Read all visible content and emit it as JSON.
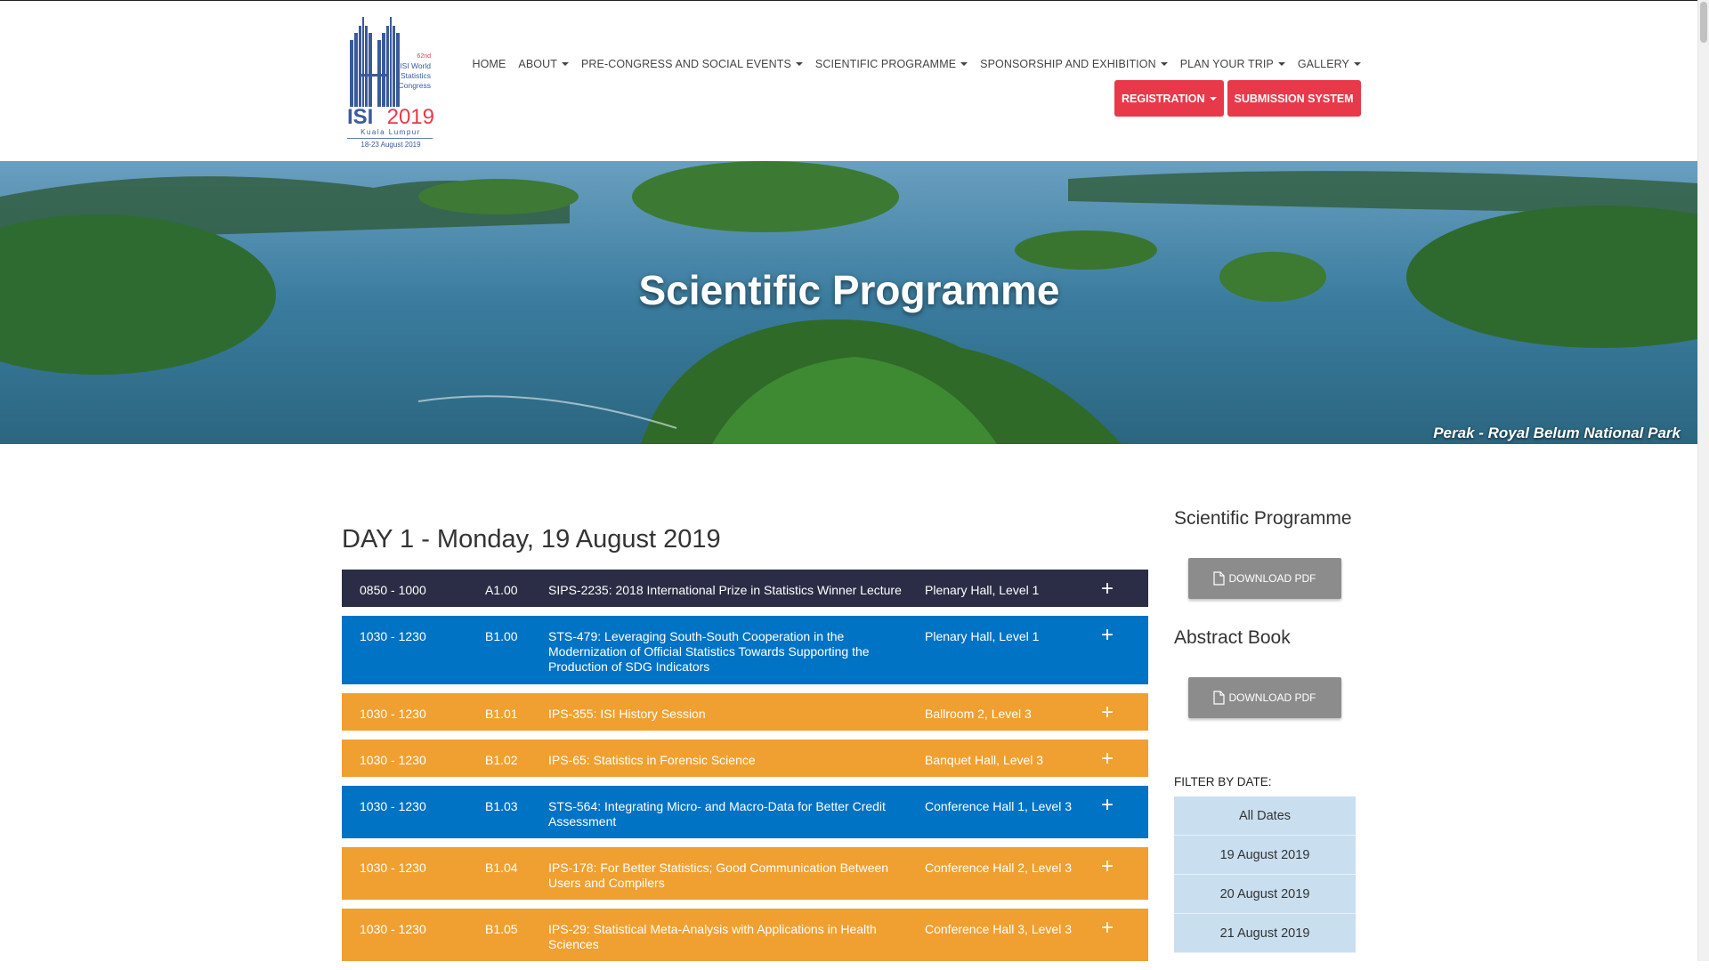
{
  "header": {
    "logo": {
      "edition": "62nd",
      "line1": "ISI World",
      "line2": "Statistics",
      "line3": "Congress",
      "brand_isi": "ISI",
      "brand_year": "2019",
      "city": "Kuala Lumpur",
      "dates": "18-23 August 2019"
    },
    "nav": [
      {
        "label": "HOME",
        "dropdown": false
      },
      {
        "label": "ABOUT",
        "dropdown": true
      },
      {
        "label": "PRE-CONGRESS AND SOCIAL EVENTS",
        "dropdown": true
      },
      {
        "label": "SCIENTIFIC PROGRAMME",
        "dropdown": true
      },
      {
        "label": "SPONSORSHIP AND EXHIBITION",
        "dropdown": true
      },
      {
        "label": "PLAN YOUR TRIP",
        "dropdown": true
      },
      {
        "label": "GALLERY",
        "dropdown": true
      }
    ],
    "registration_label": "REGISTRATION",
    "submission_label": "SUBMISSION SYSTEM"
  },
  "hero": {
    "title": "Scientific Programme",
    "caption": "Perak - Royal Belum National Park"
  },
  "main": {
    "day_title": "DAY 1 - Monday, 19 August 2019",
    "sessions": [
      {
        "time": "0850 - 1000",
        "code": "A1.00",
        "title": "SIPS-2235: 2018 International Prize in Statistics Winner Lecture",
        "venue": "Plenary Hall, Level 1",
        "color": "dark"
      },
      {
        "time": "1030 - 1230",
        "code": "B1.00",
        "title": "STS-479: Leveraging South-South Cooperation in the Modernization of Official Statistics Towards Supporting the Production of SDG Indicators",
        "venue": "Plenary Hall, Level 1",
        "color": "blue"
      },
      {
        "time": "1030 - 1230",
        "code": "B1.01",
        "title": "IPS-355: ISI History Session",
        "venue": "Ballroom 2, Level 3",
        "color": "orange"
      },
      {
        "time": "1030 - 1230",
        "code": "B1.02",
        "title": "IPS-65: Statistics in Forensic Science",
        "venue": "Banquet Hall, Level 3",
        "color": "orange"
      },
      {
        "time": "1030 - 1230",
        "code": "B1.03",
        "title": "STS-564: Integrating Micro- and Macro-Data for Better Credit Assessment",
        "venue": "Conference Hall 1, Level 3",
        "color": "blue"
      },
      {
        "time": "1030 - 1230",
        "code": "B1.04",
        "title": "IPS-178: For Better Statistics; Good Communication Between Users and Compilers",
        "venue": "Conference Hall 2, Level 3",
        "color": "orange"
      },
      {
        "time": "1030 - 1230",
        "code": "B1.05",
        "title": "IPS-29: Statistical Meta-Analysis with Applications in Health Sciences",
        "venue": "Conference Hall 3, Level 3",
        "color": "orange"
      }
    ],
    "expand_symbol": "+"
  },
  "sidebar": {
    "programme_heading": "Scientific Programme",
    "programme_download": "DOWNLOAD PDF",
    "abstract_heading": "Abstract Book",
    "abstract_download": "DOWNLOAD PDF",
    "filter_label": "FILTER BY DATE:",
    "filter_dates": [
      "All Dates",
      "19 August 2019",
      "20 August 2019",
      "21 August 2019"
    ]
  },
  "colors": {
    "dark": "#2a2d45",
    "blue": "#0073c4",
    "orange": "#f0a030",
    "red": "#e8394a",
    "filter_bg": "#c9dff0"
  }
}
